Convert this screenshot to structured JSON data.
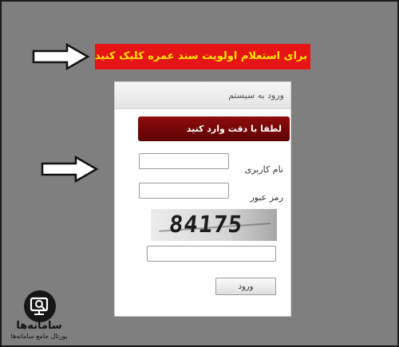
{
  "banner": {
    "text": "برای استعلام اولویت سند عمره کلیک کنید"
  },
  "login_panel": {
    "header_title": "ورود به سیستم",
    "notice": "لطفا با دقت وارد کنید",
    "username_label": "نام کاربری",
    "username_value": "",
    "password_label": "رمز عبور",
    "password_value": "",
    "captcha_text": "84175",
    "captcha_value": "",
    "submit_label": "ورود"
  },
  "logo": {
    "title": "سامانه‌ها",
    "subtitle": "پورتال جامع سامانه‌ها"
  },
  "icons": [
    "arrow-right-icon",
    "magnifier-monitor-icon"
  ],
  "colors": {
    "background": "#7f7f7f",
    "banner_bg": "#e51515",
    "banner_text": "#ffe400",
    "notice_bg": "#7a0707"
  }
}
